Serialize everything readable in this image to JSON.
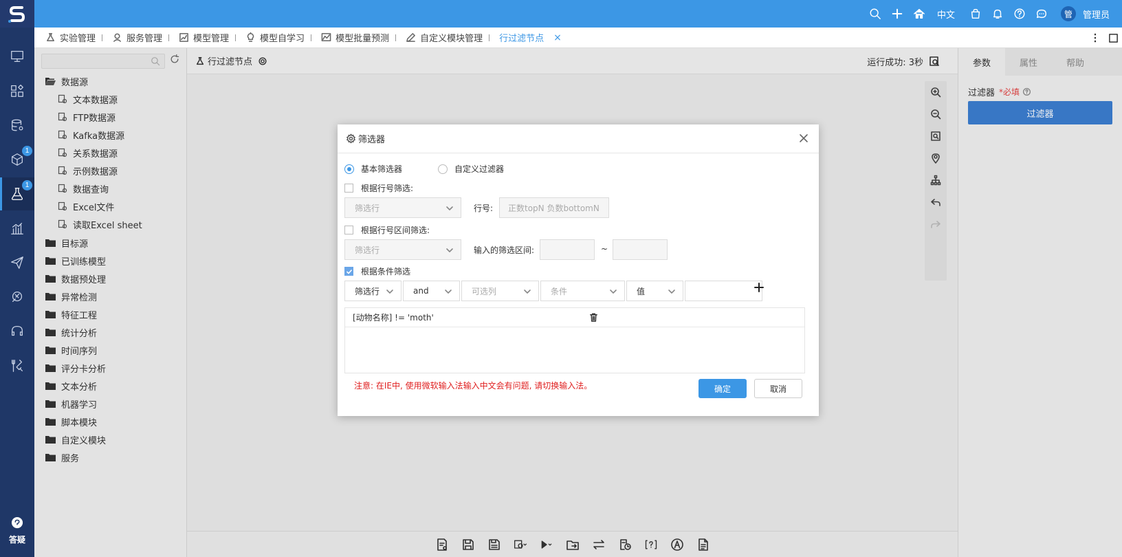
{
  "colors": {
    "primary": "#3c97e5",
    "nav_bg": "#1f3767",
    "danger": "#e02020"
  },
  "header": {
    "logo_icon": "s-logo-icon",
    "language": "中文",
    "avatar_text": "管",
    "username": "管理员",
    "icons": [
      "search-icon",
      "plus-icon",
      "home-icon",
      "lang-label",
      "bag-icon",
      "bell-icon",
      "help-circle-icon",
      "chat-icon",
      "avatar"
    ]
  },
  "nav": {
    "items": [
      {
        "icon": "monitor-icon",
        "badge": null
      },
      {
        "icon": "apps-icon",
        "badge": null
      },
      {
        "icon": "database-settings-icon",
        "badge": null
      },
      {
        "icon": "cube-icon",
        "badge": "1"
      },
      {
        "icon": "experiment-icon",
        "badge": "1"
      },
      {
        "icon": "bar-chart-icon",
        "badge": null
      },
      {
        "icon": "paper-plane-icon",
        "badge": null
      },
      {
        "icon": "model-icon",
        "badge": null
      },
      {
        "icon": "headset-icon",
        "badge": null
      },
      {
        "icon": "tools-icon",
        "badge": null
      }
    ],
    "help_label": "答疑"
  },
  "tabs": [
    {
      "label": "实验管理",
      "icon": "flask-icon"
    },
    {
      "label": "服务管理",
      "icon": "service-icon"
    },
    {
      "label": "模型管理",
      "icon": "chart-box-icon"
    },
    {
      "label": "模型自学习",
      "icon": "bulb-icon"
    },
    {
      "label": "模型批量预测",
      "icon": "line-chart-icon"
    },
    {
      "label": "自定义模块管理",
      "icon": "pen-icon"
    },
    {
      "label": "行过滤节点",
      "icon": null,
      "close": "×"
    }
  ],
  "tree": {
    "root": "数据源",
    "children": [
      "文本数据源",
      "FTP数据源",
      "Kafka数据源",
      "关系数据源",
      "示例数据源",
      "数据查询",
      "Excel文件",
      "读取Excel sheet"
    ],
    "folders": [
      "目标源",
      "已训练模型",
      "数据预处理",
      "异常检测",
      "特征工程",
      "统计分析",
      "时间序列",
      "评分卡分析",
      "文本分析",
      "机器学习",
      "脚本模块",
      "自定义模块",
      "服务"
    ]
  },
  "canvas": {
    "node_title": "行过滤节点",
    "run_status": "运行成功: 3秒"
  },
  "right_panel": {
    "tabs": [
      "参数",
      "属性",
      "帮助"
    ],
    "field_label": "过滤器",
    "required_text": "*必填",
    "button_label": "过滤器"
  },
  "modal": {
    "title": "筛选器",
    "radio_basic": "基本筛选器",
    "radio_custom": "自定义过滤器",
    "by_row_label": "根据行号筛选:",
    "row_select": "筛选行",
    "row_no_label": "行号:",
    "row_no_placeholder": "正数topN 负数bottomN",
    "by_range_label": "根据行号区间筛选:",
    "range_select": "筛选行",
    "range_label": "输入的筛选区间:",
    "range_sep": "~",
    "by_cond_label": "根据条件筛选",
    "cond_filter_select": "筛选行",
    "cond_logic_select": "and",
    "cond_column_select": "可选列",
    "cond_condition_select": "条件",
    "cond_value_select": "值",
    "cond_value_input": "",
    "conditions": [
      "[动物名称] != 'moth'"
    ],
    "notice": "注意: 在IE中, 使用微软输入法输入中文会有问题, 请切换输入法。",
    "ok": "确定",
    "cancel": "取消"
  }
}
